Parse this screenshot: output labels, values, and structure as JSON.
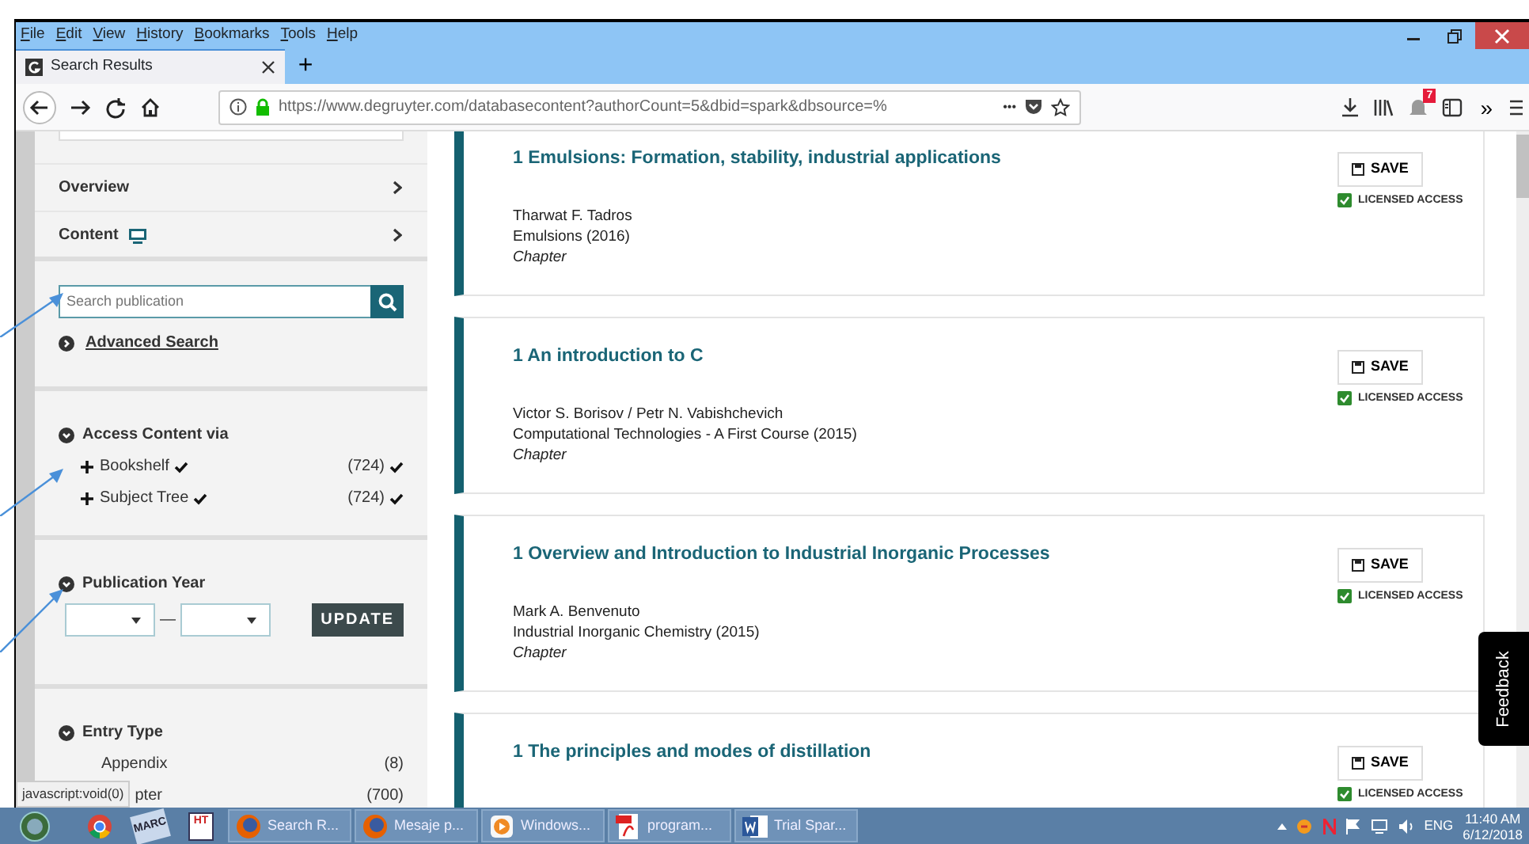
{
  "window": {
    "menu": [
      "File",
      "Edit",
      "View",
      "History",
      "Bookmarks",
      "Tools",
      "Help"
    ],
    "tabs": [
      {
        "title": "Search Results",
        "selected": true
      }
    ],
    "new_tab": "+",
    "url": "https://www.degruyter.com/databasecontent?authorCount=5&dbid=spark&dbsource=%",
    "page_actions": "•••",
    "notification_count": "7",
    "overflow": "»"
  },
  "sidebar": {
    "nav": [
      {
        "label": "Overview",
        "monitor_icon": false
      },
      {
        "label": "Content",
        "monitor_icon": true
      }
    ],
    "search": {
      "placeholder": "Search publication"
    },
    "advanced_search": "Advanced Search",
    "access": {
      "title": "Access Content via",
      "items": [
        {
          "label": "Bookshelf",
          "count": "(724)"
        },
        {
          "label": "Subject Tree",
          "count": "(724)"
        }
      ]
    },
    "publication_year": {
      "title": "Publication Year",
      "separator": "—",
      "button": "UPDATE"
    },
    "entry_type": {
      "title": "Entry Type",
      "items": [
        {
          "label": "Appendix",
          "count": "(8)"
        },
        {
          "label": "pter",
          "count": "(700)"
        }
      ]
    }
  },
  "results": [
    {
      "title": "1 Emulsions: Formation, stability, industrial applications",
      "authors": "Tharwat F. Tadros",
      "source": "Emulsions (2016)",
      "type": "Chapter",
      "save": "SAVE",
      "access": "LICENSED ACCESS"
    },
    {
      "title": "1 An introduction to C",
      "authors": "Victor S. Borisov / Petr N. Vabishchevich",
      "source": "Computational Technologies - A First Course (2015)",
      "type": "Chapter",
      "save": "SAVE",
      "access": "LICENSED ACCESS"
    },
    {
      "title": "1 Overview and Introduction to Industrial Inorganic Processes",
      "authors": "Mark A. Benvenuto",
      "source": "Industrial Inorganic Chemistry (2015)",
      "type": "Chapter",
      "save": "SAVE",
      "access": "LICENSED ACCESS"
    },
    {
      "title": "1 The principles and modes of distillation",
      "save": "SAVE",
      "access": "LICENSED ACCESS"
    }
  ],
  "feedback": "Feedback",
  "status_text": "javascript:void(0)",
  "taskbar": {
    "pinned": [
      {
        "kind": "chrome"
      },
      {
        "kind": "marc",
        "label": "MARC"
      },
      {
        "kind": "html",
        "label": "HT"
      }
    ],
    "windows": [
      {
        "kind": "firefox",
        "label": "Search R..."
      },
      {
        "kind": "firefox",
        "label": "Mesaje p..."
      },
      {
        "kind": "media",
        "label": "Windows..."
      },
      {
        "kind": "pdf",
        "label": "program..."
      },
      {
        "kind": "word",
        "label": "Trial Spar..."
      }
    ],
    "language": "ENG",
    "time": "11:40 AM",
    "date": "6/12/2018"
  }
}
